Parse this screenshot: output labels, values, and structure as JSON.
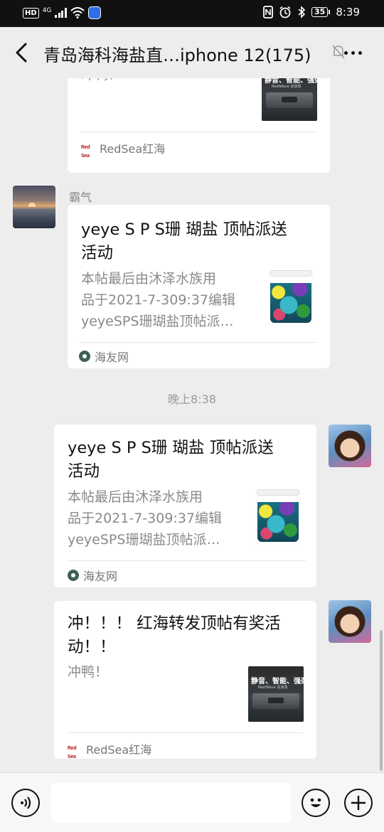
{
  "status_bar": {
    "left_badge": "HD",
    "network": "4G",
    "battery": "35",
    "time": "8:39"
  },
  "header": {
    "title": "青岛海科海盐直…iphone 12(175)",
    "back_icon": "chevron-left-icon",
    "more_icon": "more-dots-icon"
  },
  "messages": [
    {
      "type": "link-card",
      "side": "left",
      "partial": true,
      "description": "冲鸭！",
      "thumbnail": {
        "kind": "redsea-product",
        "headline": "静音、智能、强劲",
        "subline": "ReefWave 造浪泵"
      },
      "source": "RedSea红海",
      "source_logo": "Red Sea"
    },
    {
      "type": "link-card",
      "side": "left",
      "sender": "霸气",
      "title_lines": [
        "yeye S P S珊 瑚盐 顶帖派送",
        "活动"
      ],
      "description_lines": [
        "本帖最后由沐泽水族用",
        "品于2021-7-309:37编辑",
        "yeyeSPS珊瑚盐顶帖派…"
      ],
      "thumbnail": {
        "kind": "salt-bucket"
      },
      "source": "海友网"
    },
    {
      "type": "timestamp",
      "text": "晚上8:38"
    },
    {
      "type": "link-card",
      "side": "right",
      "title_lines": [
        "yeye S P S珊 瑚盐 顶帖派送",
        "活动"
      ],
      "description_lines": [
        "本帖最后由沐泽水族用",
        "品于2021-7-309:37编辑",
        "yeyeSPS珊瑚盐顶帖派…"
      ],
      "thumbnail": {
        "kind": "salt-bucket"
      },
      "source": "海友网"
    },
    {
      "type": "link-card",
      "side": "right",
      "title_lines": [
        "冲！！！ 红海转发顶帖有奖活",
        "动！！"
      ],
      "description": "冲鸭！",
      "thumbnail": {
        "kind": "redsea-product",
        "headline": "静音、智能、强劲",
        "subline": "ReefWave 造浪泵"
      },
      "source": "RedSea红海",
      "source_logo": "Red Sea"
    }
  ],
  "input_bar": {
    "voice_icon": "voice-icon",
    "emoji_icon": "emoji-icon",
    "plus_icon": "plus-icon"
  },
  "colors": {
    "background": "#ededed",
    "card": "#ffffff",
    "status_bar": "#111111"
  }
}
